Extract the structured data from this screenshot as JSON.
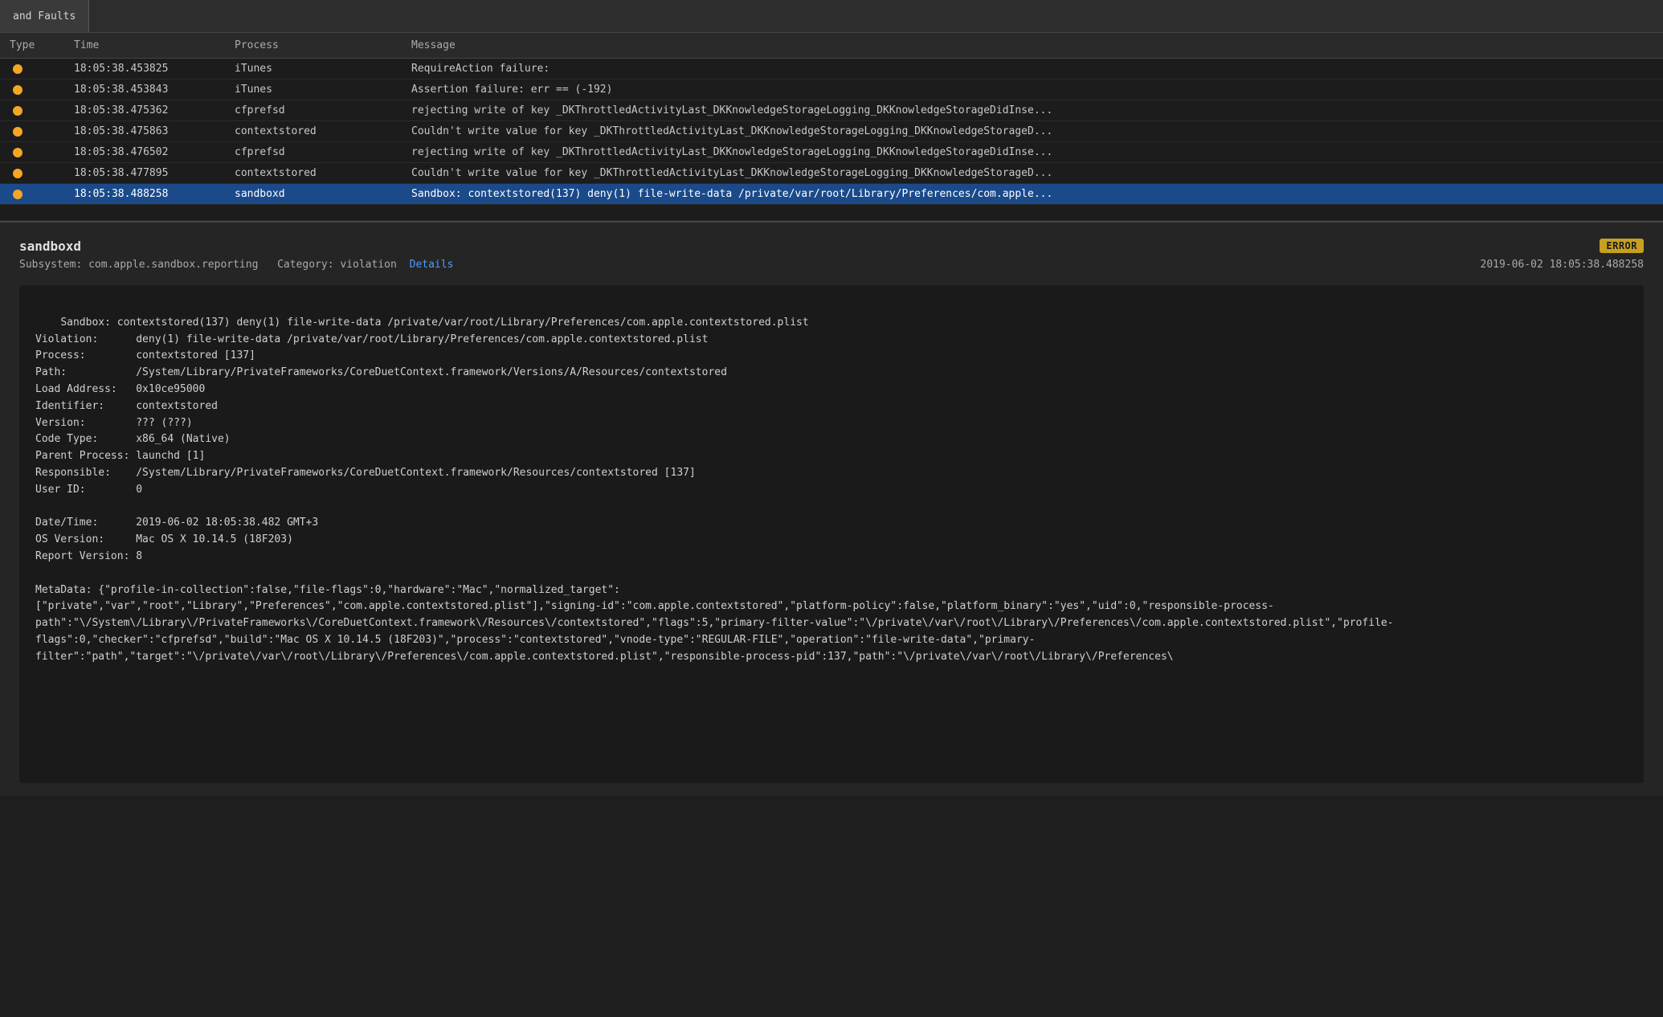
{
  "tab": {
    "label": "and Faults"
  },
  "table": {
    "headers": [
      "Type",
      "Time",
      "Process",
      "Message"
    ],
    "rows": [
      {
        "dot_color": "#f5a623",
        "time": "18:05:38.453825",
        "process": "iTunes",
        "message": "RequireAction failure:"
      },
      {
        "dot_color": "#f5a623",
        "time": "18:05:38.453843",
        "process": "iTunes",
        "message": "Assertion failure: err == (-192)"
      },
      {
        "dot_color": "#f5a623",
        "time": "18:05:38.475362",
        "process": "cfprefsd",
        "message": "rejecting write of key _DKThrottledActivityLast_DKKnowledgeStorageLogging_DKKnowledgeStorageDidInse..."
      },
      {
        "dot_color": "#f5a623",
        "time": "18:05:38.475863",
        "process": "contextstored",
        "message": "Couldn't write value for key _DKThrottledActivityLast_DKKnowledgeStorageLogging_DKKnowledgeStorageD..."
      },
      {
        "dot_color": "#f5a623",
        "time": "18:05:38.476502",
        "process": "cfprefsd",
        "message": "rejecting write of key _DKThrottledActivityLast_DKKnowledgeStorageLogging_DKKnowledgeStorageDidInse..."
      },
      {
        "dot_color": "#f5a623",
        "time": "18:05:38.477895",
        "process": "contextstored",
        "message": "Couldn't write value for key _DKThrottledActivityLast_DKKnowledgeStorageLogging_DKKnowledgeStorageD..."
      },
      {
        "dot_color": "#f5a623",
        "time": "18:05:38.488258",
        "process": "sandboxd",
        "message": "Sandbox: contextstored(137) deny(1) file-write-data /private/var/root/Library/Preferences/com.apple...",
        "selected": true
      }
    ]
  },
  "detail": {
    "title": "sandboxd",
    "badge": "ERROR",
    "subsystem": "Subsystem: com.apple.sandbox.reporting",
    "category": "Category: violation",
    "details_link": "Details",
    "timestamp": "2019-06-02 18:05:38.488258",
    "log_text": "Sandbox: contextstored(137) deny(1) file-write-data /private/var/root/Library/Preferences/com.apple.contextstored.plist\nViolation:      deny(1) file-write-data /private/var/root/Library/Preferences/com.apple.contextstored.plist\nProcess:        contextstored [137]\nPath:           /System/Library/PrivateFrameworks/CoreDuetContext.framework/Versions/A/Resources/contextstored\nLoad Address:   0x10ce95000\nIdentifier:     contextstored\nVersion:        ??? (???)\nCode Type:      x86_64 (Native)\nParent Process: launchd [1]\nResponsible:    /System/Library/PrivateFrameworks/CoreDuetContext.framework/Resources/contextstored [137]\nUser ID:        0\n\nDate/Time:      2019-06-02 18:05:38.482 GMT+3\nOS Version:     Mac OS X 10.14.5 (18F203)\nReport Version: 8\n\nMetaData: {\"profile-in-collection\":false,\"file-flags\":0,\"hardware\":\"Mac\",\"normalized_target\":\n[\"private\",\"var\",\"root\",\"Library\",\"Preferences\",\"com.apple.contextstored.plist\"],\"signing-id\":\"com.apple.contextstored\",\"platform-policy\":false,\"platform_binary\":\"yes\",\"uid\":0,\"responsible-process-path\":\"\\/System\\/Library\\/PrivateFrameworks\\/CoreDuetContext.framework\\/Resources\\/contextstored\",\"flags\":5,\"primary-filter-value\":\"\\/private\\/var\\/root\\/Library\\/Preferences\\/com.apple.contextstored.plist\",\"profile-flags\":0,\"checker\":\"cfprefsd\",\"build\":\"Mac OS X 10.14.5 (18F203)\",\"process\":\"contextstored\",\"vnode-type\":\"REGULAR-FILE\",\"operation\":\"file-write-data\",\"primary-filter\":\"path\",\"target\":\"\\/private\\/var\\/root\\/Library\\/Preferences\\/com.apple.contextstored.plist\",\"responsible-process-pid\":137,\"path\":\"\\/private\\/var\\/root\\/Library\\/Preferences\\"
  }
}
